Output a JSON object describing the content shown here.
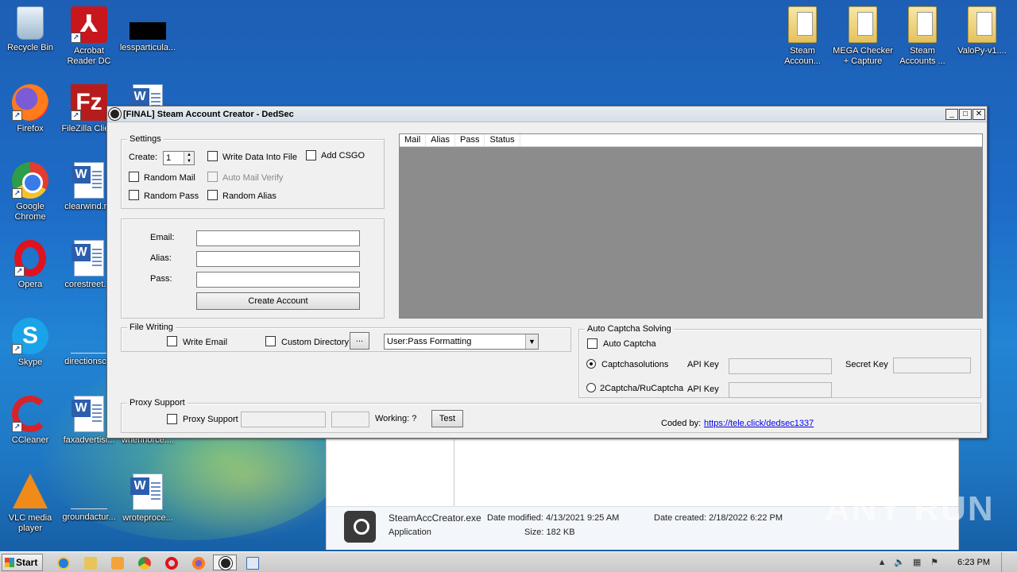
{
  "desktop": {
    "icons_left": [
      {
        "label": "Recycle Bin",
        "icon": "recycle-bin-icon"
      },
      {
        "label": "Acrobat Reader DC",
        "icon": "acrobat-icon"
      },
      {
        "label": "lessparticula...",
        "icon": "black-file-icon"
      },
      {
        "label": "Firefox",
        "icon": "firefox-icon"
      },
      {
        "label": "FileZilla Clie...",
        "icon": "filezilla-icon"
      },
      {
        "label": "Google Chrome",
        "icon": "chrome-icon"
      },
      {
        "label": "clearwind.r...",
        "icon": "word-doc-icon"
      },
      {
        "label": "Opera",
        "icon": "opera-icon"
      },
      {
        "label": "corestreet....",
        "icon": "word-doc-icon"
      },
      {
        "label": "Skype",
        "icon": "skype-icon"
      },
      {
        "label": "directionsc...",
        "icon": "blank-file-icon"
      },
      {
        "label": "CCleaner",
        "icon": "ccleaner-icon"
      },
      {
        "label": "faxadvertisi...",
        "icon": "word-doc-icon"
      },
      {
        "label": "whenhorce....",
        "icon": "word-doc-icon"
      },
      {
        "label": "VLC media player",
        "icon": "vlc-icon"
      },
      {
        "label": "groundactur...",
        "icon": "blank-file-icon"
      },
      {
        "label": "wroteproce...",
        "icon": "word-doc-icon"
      }
    ],
    "icons_right": [
      {
        "label": "Steam Accoun...",
        "icon": "folder-icon"
      },
      {
        "label": "MEGA Checker + Capture",
        "icon": "folder-icon"
      },
      {
        "label": "Steam Accounts ...",
        "icon": "folder-icon"
      },
      {
        "label": "ValoPy-v1....",
        "icon": "folder-icon"
      }
    ]
  },
  "window": {
    "title": "[FINAL] Steam Account Creator - DedSec",
    "controls": {
      "minimize": "_",
      "maximize": "□",
      "close": "✕"
    },
    "settings": {
      "legend": "Settings",
      "create_label": "Create:",
      "create_value": "1",
      "write_data": "Write Data Into File",
      "add_csgo": "Add CSGO",
      "random_mail": "Random Mail",
      "auto_mail_verify": "Auto Mail Verify",
      "random_pass": "Random Pass",
      "random_alias": "Random Alias"
    },
    "account": {
      "email_label": "Email:",
      "alias_label": "Alias:",
      "pass_label": "Pass:",
      "create_button": "Create Account"
    },
    "list": {
      "columns": [
        "Mail",
        "Alias",
        "Pass",
        "Status"
      ]
    },
    "file_writing": {
      "legend": "File Writing",
      "write_email": "Write Email",
      "custom_directory": "Custom Directory",
      "browse": "...",
      "format_selected": "User:Pass Formatting"
    },
    "captcha": {
      "legend": "Auto Captcha Solving",
      "auto_captcha": "Auto Captcha",
      "captchasolutions": "Captchasolutions",
      "api_key_label": "API Key",
      "secret_key_label": "Secret Key",
      "rucaptcha": "2Captcha/RuCaptcha",
      "api_key_label2": "API Key",
      "selected": "Captchasolutions"
    },
    "proxy": {
      "legend": "Proxy Support",
      "proxy_support": "Proxy Support",
      "working": "Working: ?",
      "test_button": "Test"
    },
    "coded_by_label": "Coded by:",
    "coded_by_link": "https://tele.click/dedsec1337"
  },
  "explorer": {
    "file_name": "SteamAccCreator.exe",
    "file_type": "Application",
    "date_modified": "Date modified: 4/13/2021 9:25 AM",
    "size": "Size: 182 KB",
    "date_created": "Date created: 2/18/2022 6:22 PM"
  },
  "watermark": "ANY RUN",
  "taskbar": {
    "start_label": "Start",
    "pinned": [
      "ie-icon",
      "explorer-icon",
      "media-player-icon",
      "chrome-icon",
      "opera-icon",
      "firefox-icon",
      "steam-icon",
      "window-icon"
    ],
    "clock": "6:23 PM"
  }
}
